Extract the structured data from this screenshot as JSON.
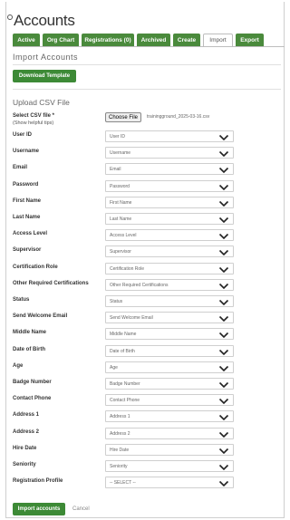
{
  "page": {
    "title": "Accounts"
  },
  "tabs": [
    {
      "label": "Active",
      "active": false
    },
    {
      "label": "Org Chart",
      "active": false
    },
    {
      "label": "Registrations (0)",
      "active": false
    },
    {
      "label": "Archived",
      "active": false
    },
    {
      "label": "Create",
      "active": false
    },
    {
      "label": "Import",
      "active": true
    },
    {
      "label": "Export",
      "active": false
    }
  ],
  "import": {
    "section_title": "Import Accounts",
    "download_label": "Download Template",
    "upload_title": "Upload CSV File",
    "csv_label": "Select CSV file *",
    "csv_help": "(Show helpful tips)",
    "choose_label": "Choose File",
    "file_name": "trainingground_2025-03-16.csv"
  },
  "fields": [
    {
      "label": "User ID",
      "value": "User ID"
    },
    {
      "label": "Username",
      "value": "Username"
    },
    {
      "label": "Email",
      "value": "Email"
    },
    {
      "label": "Password",
      "value": "Password"
    },
    {
      "label": "First Name",
      "value": "First Name"
    },
    {
      "label": "Last Name",
      "value": "Last Name"
    },
    {
      "label": "Access Level",
      "value": "Access Level"
    },
    {
      "label": "Supervisor",
      "value": "Supervisor"
    },
    {
      "label": "Certification Role",
      "value": "Certification Role"
    },
    {
      "label": "Other Required Certifications",
      "value": "Other Required Certifications"
    },
    {
      "label": "Status",
      "value": "Status"
    },
    {
      "label": "Send Welcome Email",
      "value": "Send Welcome Email"
    },
    {
      "label": "Middle Name",
      "value": "Middle Name"
    },
    {
      "label": "Date of Birth",
      "value": "Date of Birth"
    },
    {
      "label": "Age",
      "value": "Age"
    },
    {
      "label": "Badge Number",
      "value": "Badge Number"
    },
    {
      "label": "Contact Phone",
      "value": "Contact Phone"
    },
    {
      "label": "Address 1",
      "value": "Address 1"
    },
    {
      "label": "Address 2",
      "value": "Address 2"
    },
    {
      "label": "Hire Date",
      "value": "Hire Date"
    },
    {
      "label": "Seniority",
      "value": "Seniority"
    },
    {
      "label": "Registration Profile",
      "value": "-- SELECT --"
    }
  ],
  "actions": {
    "import_label": "Import accounts",
    "cancel_label": "Cancel"
  },
  "colors": {
    "accent": "#3d8a36"
  }
}
